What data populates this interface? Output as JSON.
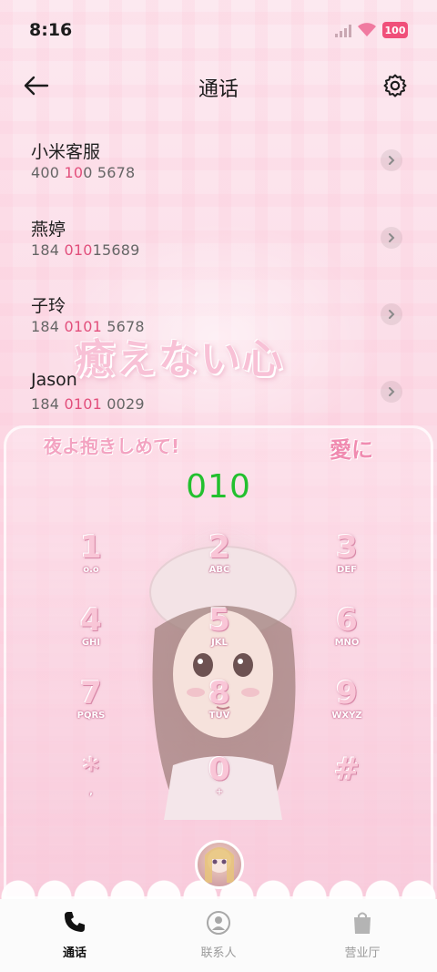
{
  "status_bar": {
    "time": "8:16",
    "battery": "100"
  },
  "header": {
    "title": "通话"
  },
  "calls": [
    {
      "name": "小米客服",
      "number_parts": [
        "400 ",
        "10",
        "0 5678"
      ]
    },
    {
      "name": "燕婷",
      "number_parts": [
        "184 ",
        "010",
        "15689"
      ]
    },
    {
      "name": "子玲",
      "number_parts": [
        "184 ",
        "0101",
        " 5678"
      ]
    },
    {
      "name": "Jason",
      "number_parts": [
        "184 ",
        "0101",
        " 0029"
      ]
    }
  ],
  "decoration": {
    "title_text": "癒えない心",
    "subtitle_left": "夜よ抱きしめて!",
    "subtitle_right": "愛に"
  },
  "dialer": {
    "dialed": "010",
    "keys": [
      {
        "digit": "1",
        "letters": "o.o"
      },
      {
        "digit": "2",
        "letters": "ABC"
      },
      {
        "digit": "3",
        "letters": "DEF"
      },
      {
        "digit": "4",
        "letters": "GHI"
      },
      {
        "digit": "5",
        "letters": "JKL"
      },
      {
        "digit": "6",
        "letters": "MNO"
      },
      {
        "digit": "7",
        "letters": "PQRS"
      },
      {
        "digit": "8",
        "letters": "TUV"
      },
      {
        "digit": "9",
        "letters": "WXYZ"
      },
      {
        "digit": "*",
        "letters": ","
      },
      {
        "digit": "0",
        "letters": "+"
      },
      {
        "digit": "#",
        "letters": ""
      }
    ]
  },
  "nav": {
    "tabs": [
      {
        "label": "通话",
        "icon": "phone-icon",
        "active": true
      },
      {
        "label": "联系人",
        "icon": "contact-icon",
        "active": false
      },
      {
        "label": "营业厅",
        "icon": "shopping-bag-icon",
        "active": false
      }
    ]
  },
  "colors": {
    "accent": "#e24f7c",
    "dialed": "#22c02e",
    "battery": "#f04f7a"
  }
}
